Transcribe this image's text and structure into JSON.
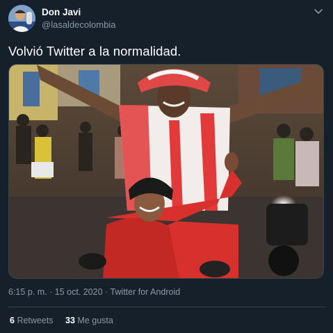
{
  "author": {
    "display_name": "Don Javi",
    "handle": "@lasaldecolombia"
  },
  "tweet": {
    "text": "Volvió Twitter a la normalidad.",
    "time": "6:15 p. m.",
    "separator": "·",
    "date": "15 oct. 2020",
    "source": "Twitter for Android"
  },
  "stats": {
    "retweets_count": "6",
    "retweets_label": "Retweets",
    "likes_count": "33",
    "likes_label": "Me gusta"
  },
  "icons": {
    "menu": "chevron-down-icon"
  },
  "colors": {
    "background": "#15202b",
    "secondary_text": "#8899a6",
    "border": "#38444d"
  }
}
